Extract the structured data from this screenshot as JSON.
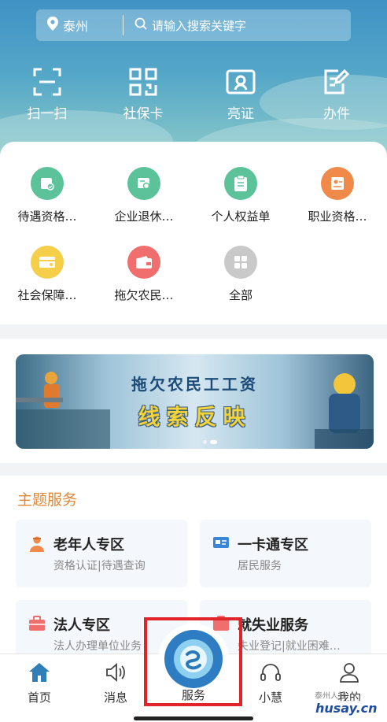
{
  "header": {
    "city": "泰州",
    "search_placeholder": "请输入搜索关键字",
    "quick_actions": [
      {
        "label": "扫一扫",
        "icon": "scan-icon"
      },
      {
        "label": "社保卡",
        "icon": "qr-card-icon"
      },
      {
        "label": "亮证",
        "icon": "id-certificate-icon"
      },
      {
        "label": "办件",
        "icon": "edit-document-icon"
      }
    ]
  },
  "services": [
    {
      "label": "待遇资格…",
      "color": "#5cc29a",
      "icon": "qualification-icon"
    },
    {
      "label": "企业退休…",
      "color": "#5cc29a",
      "icon": "retirement-icon"
    },
    {
      "label": "个人权益单",
      "color": "#5cc29a",
      "icon": "clipboard-icon"
    },
    {
      "label": "职业资格…",
      "color": "#f08a4b",
      "icon": "certificate-icon"
    },
    {
      "label": "社会保障…",
      "color": "#f5cf4a",
      "icon": "card-icon"
    },
    {
      "label": "拖欠农民…",
      "color": "#f06e6e",
      "icon": "wallet-icon"
    },
    {
      "label": "全部",
      "color": "#c9c9c9",
      "icon": "grid-icon"
    }
  ],
  "banner": {
    "line1": "拖欠农民工工资",
    "line2": "线索反映"
  },
  "theme": {
    "title": "主题服务",
    "cards": [
      {
        "title": "老年人专区",
        "subtitle": "资格认证|待遇查询",
        "icon": "elderly-icon",
        "color": "#f08a4b"
      },
      {
        "title": "一卡通专区",
        "subtitle": "居民服务",
        "icon": "id-card-icon",
        "color": "#3a86d6"
      },
      {
        "title": "法人专区",
        "subtitle": "法人办理单位业务",
        "icon": "briefcase-icon",
        "color": "#f06e6e"
      },
      {
        "title": "就失业服务",
        "subtitle": "失业登记|就业困难…",
        "icon": "employment-icon",
        "color": "#f06e6e"
      }
    ]
  },
  "nav": {
    "home": "首页",
    "messages": "消息",
    "service": "服务",
    "assistant": "小慧",
    "mine": "我的",
    "active_color": "#2f7fb8"
  },
  "watermark": {
    "site": "husay.cn",
    "small": "泰州人社"
  }
}
